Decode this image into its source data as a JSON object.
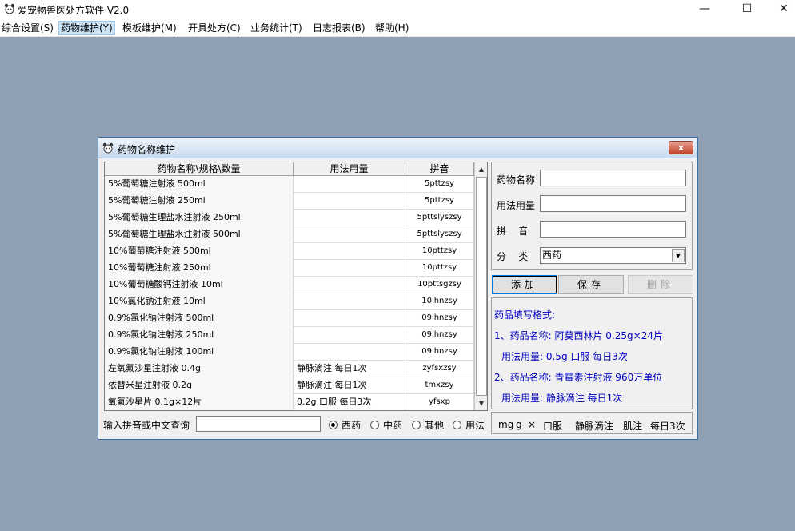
{
  "app": {
    "title": "爱宠物兽医处方软件 V2.0"
  },
  "window_controls": {
    "minimize": "—",
    "maximize": "☐",
    "close": "✕"
  },
  "menu": [
    {
      "label": "综合设置(S)"
    },
    {
      "label": "药物维护(Y)"
    },
    {
      "label": "模板维护(M)"
    },
    {
      "label": "开具处方(C)"
    },
    {
      "label": "业务统计(T)"
    },
    {
      "label": "日志报表(B)"
    },
    {
      "label": "帮助(H)"
    }
  ],
  "dialog": {
    "title": "药物名称维护",
    "close": "x",
    "columns": [
      "药物名称\\规格\\数量",
      "用法用量",
      "拼音"
    ],
    "rows": [
      {
        "name": "5%葡萄糖注射液  500ml",
        "usage": "",
        "pinyin": "5pttzsy"
      },
      {
        "name": "5%葡萄糖注射液  250ml",
        "usage": "",
        "pinyin": "5pttzsy"
      },
      {
        "name": "5%葡萄糖生理盐水注射液 250ml",
        "usage": "",
        "pinyin": "5pttslyszsy"
      },
      {
        "name": "5%葡萄糖生理盐水注射液  500ml",
        "usage": "",
        "pinyin": "5pttslyszsy"
      },
      {
        "name": "10%葡萄糖注射液  500ml",
        "usage": "",
        "pinyin": "10pttzsy"
      },
      {
        "name": "10%葡萄糖注射液  250ml",
        "usage": "",
        "pinyin": "10pttzsy"
      },
      {
        "name": "10%葡萄糖酸钙注射液  10ml",
        "usage": "",
        "pinyin": "10pttsgzsy"
      },
      {
        "name": "10%氯化钠注射液  10ml",
        "usage": "",
        "pinyin": "10lhnzsy"
      },
      {
        "name": "0.9%氯化钠注射液  500ml",
        "usage": "",
        "pinyin": "09lhnzsy"
      },
      {
        "name": "0.9%氯化钠注射液  250ml",
        "usage": "",
        "pinyin": "09lhnzsy"
      },
      {
        "name": "0.9%氯化钠注射液  100ml",
        "usage": "",
        "pinyin": "09lhnzsy"
      },
      {
        "name": "左氧氟沙星注射液  0.4g",
        "usage": "静脉滴注  每日1次",
        "pinyin": "zyfsxzsy"
      },
      {
        "name": "依替米星注射液 0.2g",
        "usage": "静脉滴注  每日1次",
        "pinyin": "tmxzsy"
      },
      {
        "name": "氧氟沙星片 0.1g×12片",
        "usage": "0.2g 口服 每日3次",
        "pinyin": "yfsxp"
      }
    ],
    "search": {
      "label": "输入拼音或中文查询",
      "value": "",
      "options": [
        {
          "label": "西药",
          "checked": true
        },
        {
          "label": "中药",
          "checked": false
        },
        {
          "label": "其他",
          "checked": false
        },
        {
          "label": "用法",
          "checked": false
        }
      ]
    },
    "form": {
      "name_label": "药物名称",
      "name_value": "",
      "usage_label": "用法用量",
      "usage_value": "",
      "pinyin_label": "拼    音",
      "pinyin_value": "",
      "category_label": "分    类",
      "category_value": "西药"
    },
    "buttons": {
      "add": "添加",
      "save": "保存",
      "delete": "删除"
    },
    "format_help": {
      "heading": "药品填写格式:",
      "line1": "1、药品名称: 阿莫西林片 0.25g×24片",
      "line2": "用法用量: 0.5g 口服  每日3次",
      "line3": "2、药品名称: 青霉素注射液 960万单位",
      "line4": "用法用量: 静脉滴注  每日1次"
    },
    "quick_inputs": [
      "mg",
      "g",
      "×",
      "口服",
      "静脉滴注",
      "肌注",
      "每日3次"
    ]
  }
}
